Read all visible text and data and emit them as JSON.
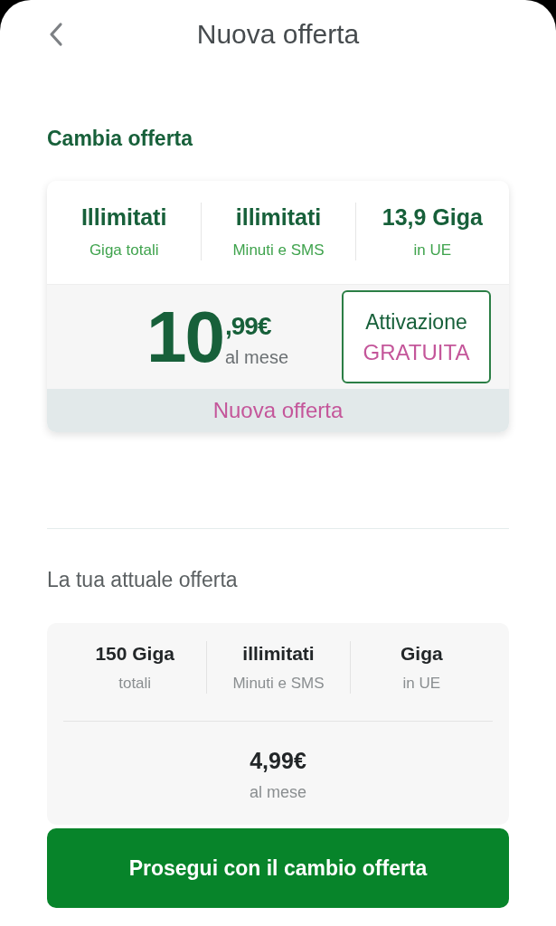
{
  "header": {
    "title": "Nuova offerta"
  },
  "new_offer": {
    "heading": "Cambia offerta",
    "features": [
      {
        "value": "Illimitati",
        "label": "Giga totali"
      },
      {
        "value": "illimitati",
        "label": "Minuti e SMS"
      },
      {
        "value": "13,9 Giga",
        "label": "in UE"
      }
    ],
    "price": {
      "integer": "10",
      "decimals": ",99€",
      "period": "al mese"
    },
    "activation": {
      "line_1": "Attivazione",
      "line_2": "GRATUITA"
    },
    "banner": "Nuova offerta"
  },
  "current_offer": {
    "heading": "La tua attuale offerta",
    "features": [
      {
        "value": "150 Giga",
        "label": "totali"
      },
      {
        "value": "illimitati",
        "label": "Minuti e SMS"
      },
      {
        "value": "Giga",
        "label": "in UE"
      }
    ],
    "price": "4,99€",
    "period": "al mese"
  },
  "button": {
    "label": "Prosegui con il cambio offerta"
  }
}
